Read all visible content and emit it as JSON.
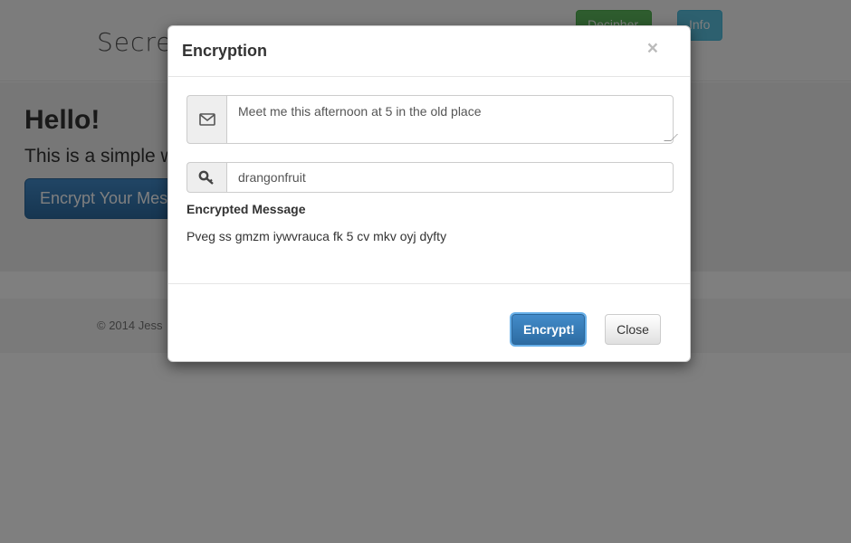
{
  "navbar": {
    "brand": "Secret",
    "decipher_label": "Decipher",
    "info_label": "Info"
  },
  "jumbotron": {
    "title": "Hello!",
    "text": "This is a simple w",
    "button_label": "Encrypt Your Mes"
  },
  "footer": {
    "text": "© 2014 Jess"
  },
  "modal": {
    "title": "Encryption",
    "close_glyph": "×",
    "message_value": "Meet me this afternoon at 5 in the old place",
    "message_icon": "envelope-icon",
    "key_value": "drangonfruit",
    "key_icon": "key-icon",
    "result_label": "Encrypted Message",
    "result_text": "Pveg ss gmzm iywvrauca fk 5 cv mkv oyj dyfty",
    "encrypt_label": "Encrypt!",
    "close_label": "Close"
  },
  "colors": {
    "primary": "#428bca",
    "success": "#5cb85c",
    "info": "#5bc0de"
  }
}
